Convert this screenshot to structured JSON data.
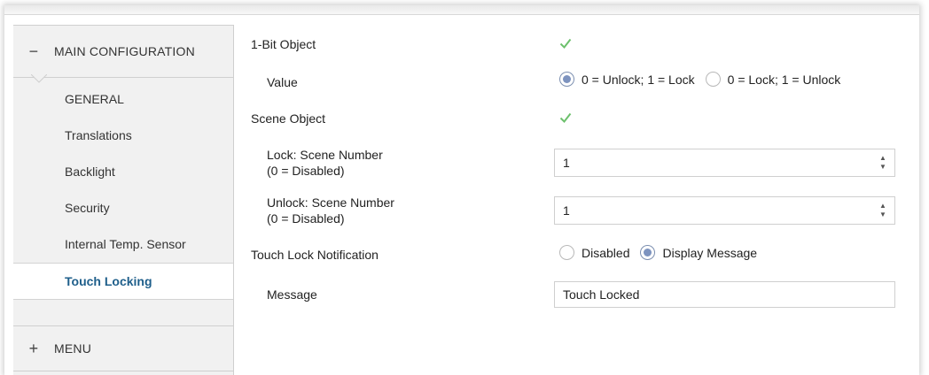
{
  "sidebar": {
    "main_section": {
      "sign": "−",
      "label": "MAIN CONFIGURATION"
    },
    "items": [
      {
        "label": "GENERAL"
      },
      {
        "label": "Translations"
      },
      {
        "label": "Backlight"
      },
      {
        "label": "Security"
      },
      {
        "label": "Internal Temp. Sensor"
      },
      {
        "label": "Touch Locking",
        "active": true
      }
    ],
    "menu_section": {
      "sign": "+",
      "label": "MENU"
    }
  },
  "content": {
    "one_bit_object": {
      "label": "1-Bit Object",
      "checked": true
    },
    "value": {
      "label": "Value",
      "options": [
        {
          "label": "0 = Unlock; 1 = Lock",
          "selected": true
        },
        {
          "label": "0 = Lock; 1 = Unlock",
          "selected": false
        }
      ]
    },
    "scene_object": {
      "label": "Scene Object",
      "checked": true
    },
    "lock_scene": {
      "label_line1": "Lock: Scene Number",
      "label_line2": "(0 = Disabled)",
      "value": "1"
    },
    "unlock_scene": {
      "label_line1": "Unlock: Scene Number",
      "label_line2": "(0 = Disabled)",
      "value": "1"
    },
    "touch_lock_notification": {
      "label": "Touch Lock Notification",
      "options": [
        {
          "label": "Disabled",
          "selected": false
        },
        {
          "label": "Display Message",
          "selected": true
        }
      ]
    },
    "message": {
      "label": "Message",
      "value": "Touch Locked"
    }
  },
  "colors": {
    "active_nav_text": "#1f5f8b",
    "check": "#6cc06c",
    "radio_fill": "#7d93bf"
  }
}
